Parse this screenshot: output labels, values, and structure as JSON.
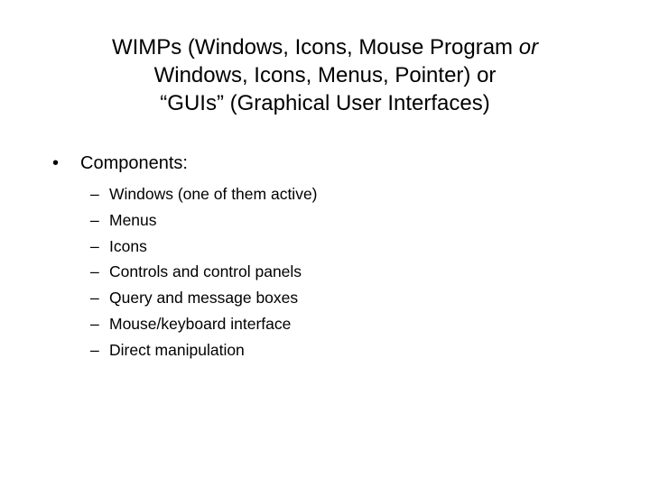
{
  "slide": {
    "title": {
      "line1_pre": "WIMPs (Windows, Icons, Mouse Program ",
      "line1_ital": "or",
      "line2": "Windows, Icons, Menus, Pointer) or",
      "line3": "“GUIs” (Graphical User Interfaces)"
    },
    "bullet": {
      "marker": "•",
      "label": "Components:"
    },
    "sub_marker": "–",
    "components": [
      "Windows (one of them active)",
      "Menus",
      "Icons",
      "Controls and control panels",
      "Query and message boxes",
      "Mouse/keyboard interface",
      "Direct manipulation"
    ]
  }
}
